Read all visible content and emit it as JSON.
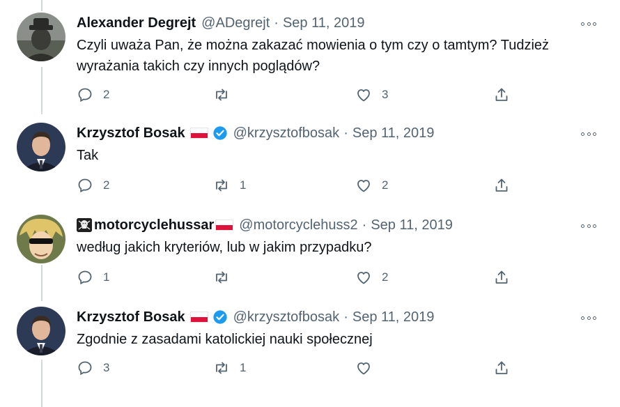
{
  "tweets": [
    {
      "name": "Alexander Degrejt",
      "handle": "@ADegrejt",
      "sep": "·",
      "date": "Sep 11, 2019",
      "text": "Czyli uważa Pan, że można zakazać mowienia o tym czy o tamtym? Tudzież wyrażania takich czy innych poglądów?",
      "replies": "2",
      "retweets": "",
      "likes": "3",
      "verified": false,
      "flag": false
    },
    {
      "name": "Krzysztof Bosak",
      "handle": "@krzysztofbosak",
      "sep": "·",
      "date": "Sep 11, 2019",
      "text": "Tak",
      "replies": "2",
      "retweets": "1",
      "likes": "2",
      "verified": true,
      "flag": true
    },
    {
      "name": "motorcyclehussar",
      "handle": "@motorcyclehuss2",
      "sep": "·",
      "date": "Sep 11, 2019",
      "text": "według jakich kryteriów, lub w jakim przypadku?",
      "replies": "1",
      "retweets": "",
      "likes": "2",
      "verified": false,
      "flag": true
    },
    {
      "name": "Krzysztof Bosak",
      "handle": "@krzysztofbosak",
      "sep": "·",
      "date": "Sep 11, 2019",
      "text": "Zgodnie z zasadami katolickiej nauki społecznej",
      "replies": "3",
      "retweets": "1",
      "likes": "",
      "verified": true,
      "flag": true
    }
  ],
  "colors": {
    "text": "#0f1419",
    "muted": "#536471",
    "verified": "#1d9bf0",
    "thread_line": "#cfd9de"
  },
  "icons": [
    "reply-icon",
    "retweet-icon",
    "like-icon",
    "share-icon",
    "more-icon",
    "verified-icon",
    "flag-icon",
    "skull-icon"
  ]
}
